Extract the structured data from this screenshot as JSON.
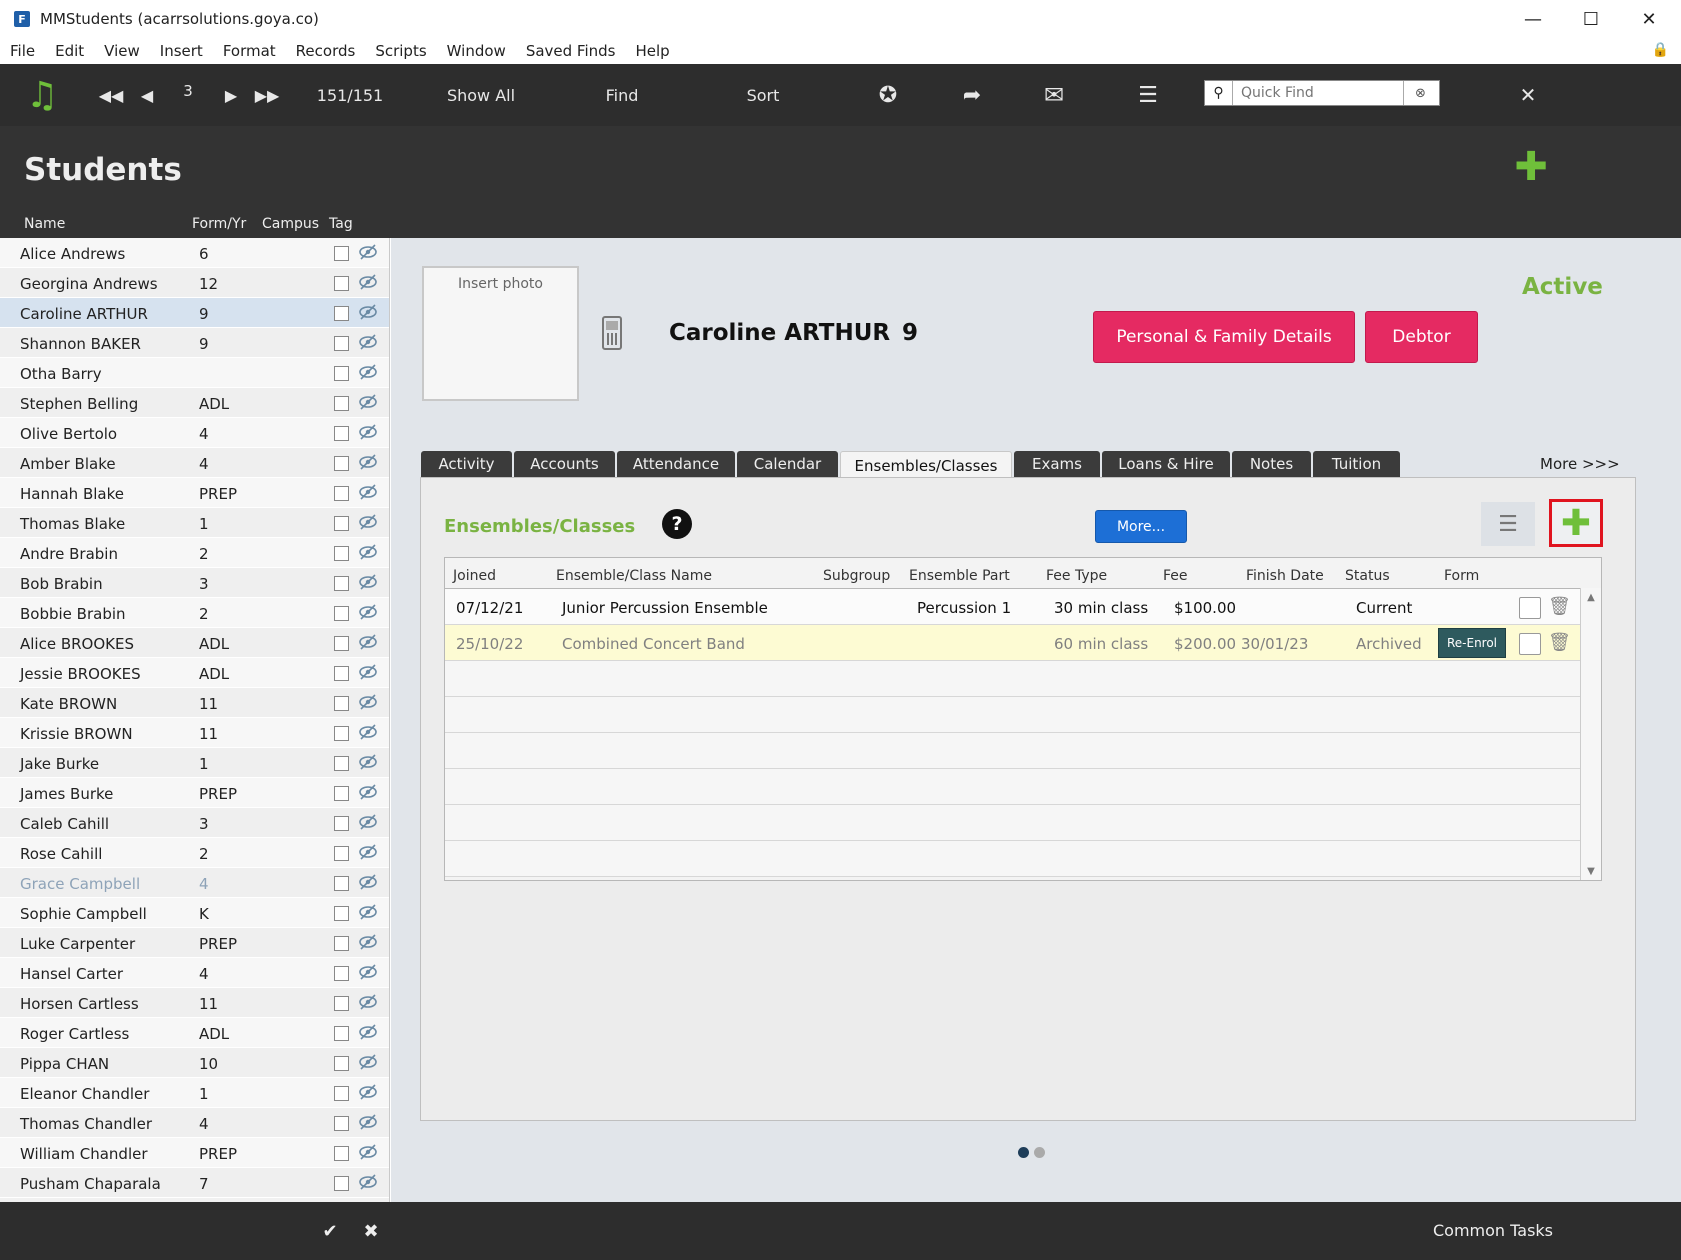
{
  "window": {
    "title": "MMStudents (acarrsolutions.goya.co)"
  },
  "menu": [
    "File",
    "Edit",
    "View",
    "Insert",
    "Format",
    "Records",
    "Scripts",
    "Window",
    "Saved Finds",
    "Help"
  ],
  "toolbar": {
    "record_number": "3",
    "record_count": "151/151",
    "show_all": "Show All",
    "find": "Find",
    "sort": "Sort",
    "quick_find_placeholder": "Quick Find"
  },
  "header": {
    "title": "Students",
    "columns": {
      "name": "Name",
      "form": "Form/Yr",
      "campus": "Campus",
      "tag": "Tag"
    }
  },
  "students": [
    {
      "name": "Alice Andrews",
      "form": "6"
    },
    {
      "name": "Georgina Andrews",
      "form": "12"
    },
    {
      "name": "Caroline ARTHUR",
      "form": "9"
    },
    {
      "name": "Shannon BAKER",
      "form": "9"
    },
    {
      "name": "Otha Barry",
      "form": ""
    },
    {
      "name": "Stephen Belling",
      "form": "ADL"
    },
    {
      "name": "Olive Bertolo",
      "form": "4"
    },
    {
      "name": "Amber Blake",
      "form": "4"
    },
    {
      "name": "Hannah Blake",
      "form": "PREP"
    },
    {
      "name": "Thomas Blake",
      "form": "1"
    },
    {
      "name": "Andre Brabin",
      "form": "2"
    },
    {
      "name": "Bob Brabin",
      "form": "3"
    },
    {
      "name": "Bobbie Brabin",
      "form": "2"
    },
    {
      "name": "Alice BROOKES",
      "form": "ADL"
    },
    {
      "name": "Jessie BROOKES",
      "form": "ADL"
    },
    {
      "name": "Kate BROWN",
      "form": "11"
    },
    {
      "name": "Krissie BROWN",
      "form": "11"
    },
    {
      "name": "Jake Burke",
      "form": "1"
    },
    {
      "name": "James Burke",
      "form": "PREP"
    },
    {
      "name": "Caleb Cahill",
      "form": "3"
    },
    {
      "name": "Rose Cahill",
      "form": "2"
    },
    {
      "name": "Grace Campbell",
      "form": "4"
    },
    {
      "name": "Sophie Campbell",
      "form": "K"
    },
    {
      "name": "Luke Carpenter",
      "form": "PREP"
    },
    {
      "name": "Hansel Carter",
      "form": "4"
    },
    {
      "name": "Horsen Cartless",
      "form": "11"
    },
    {
      "name": "Roger Cartless",
      "form": "ADL"
    },
    {
      "name": "Pippa CHAN",
      "form": "10"
    },
    {
      "name": "Eleanor Chandler",
      "form": "1"
    },
    {
      "name": "Thomas Chandler",
      "form": "4"
    },
    {
      "name": "William Chandler",
      "form": "PREP"
    },
    {
      "name": "Pusham Chaparala",
      "form": "7"
    }
  ],
  "detail": {
    "insert_photo": "Insert photo",
    "student_name": "Caroline ARTHUR",
    "student_form": "9",
    "status": "Active",
    "personal_btn": "Personal & Family Details",
    "debtor_btn": "Debtor"
  },
  "tabs": [
    "Activity",
    "Accounts",
    "Attendance",
    "Calendar",
    "Ensembles/Classes",
    "Exams",
    "Loans & Hire",
    "Notes",
    "Tuition"
  ],
  "more_tabs": "More >>>",
  "ensembles": {
    "title": "Ensembles/Classes",
    "help": "?",
    "more_btn": "More...",
    "columns": {
      "joined": "Joined",
      "name": "Ensemble/Class Name",
      "subgroup": "Subgroup",
      "part": "Ensemble Part",
      "fee_type": "Fee Type",
      "fee": "Fee",
      "finish": "Finish Date",
      "status": "Status",
      "form": "Form"
    },
    "rows": [
      {
        "joined": "07/12/21",
        "name": "Junior Percussion Ensemble",
        "subgroup": "",
        "part": "Percussion 1",
        "fee_type": "30 min class",
        "fee": "$100.00",
        "finish": "",
        "status": "Current",
        "form": ""
      },
      {
        "joined": "25/10/22",
        "name": "Combined Concert Band",
        "subgroup": "",
        "part": "",
        "fee_type": "60 min class",
        "fee": "$200.00",
        "finish": "30/01/23",
        "status": "Archived",
        "form": "Re-Enrol"
      }
    ]
  },
  "bottom": {
    "common_tasks": "Common Tasks"
  },
  "colors": {
    "accent_green": "#7ab342",
    "pink": "#e52a62",
    "toolbar": "#2d2d2d",
    "highlight_red": "#e0141f"
  }
}
